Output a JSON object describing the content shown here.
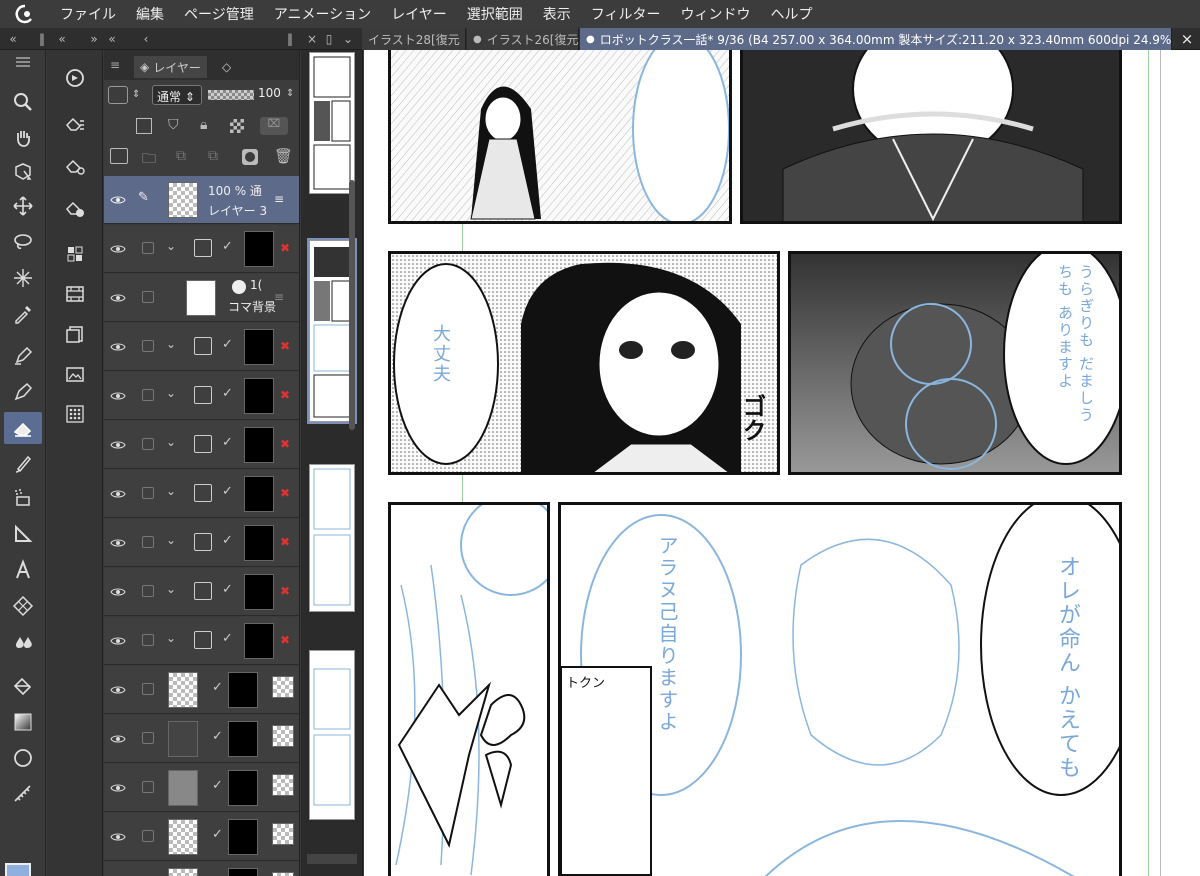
{
  "menubar": {
    "items": [
      "ファイル",
      "編集",
      "ページ管理",
      "アニメーション",
      "レイヤー",
      "選択範囲",
      "表示",
      "フィルター",
      "ウィンドウ",
      "ヘルプ"
    ]
  },
  "tabs": {
    "items": [
      {
        "label": "イラスト28[復元"
      },
      {
        "label": "イラスト26[復元"
      },
      {
        "label": "ロボットクラス一話* 9/36 (B4 257.00 x 364.00mm 製本サイズ:211.20 x 323.40mm 600dpi 24.9%)"
      }
    ],
    "close_glyph": "×"
  },
  "layer_panel": {
    "tab_label": "レイヤー",
    "blend_mode": "通常",
    "opacity": "100",
    "selected_layer": {
      "opacity_text": "100 % 通",
      "name": "レイヤー 3"
    },
    "frame_layer": {
      "name": "コマ背景",
      "opacity_text": "1("
    }
  },
  "canvas": {
    "bubble_texts": [
      "大丈夫",
      "うらぎりも だましうちも ありますよ",
      "アラヌ己自りますよ",
      "オレが命ん かえても"
    ],
    "sfx_text": "ゴク",
    "caption_text": "トクン"
  },
  "colors": {
    "accent": "#5d6a8a",
    "main_color": "#8fb0df",
    "sub_color": "#ffffff"
  }
}
